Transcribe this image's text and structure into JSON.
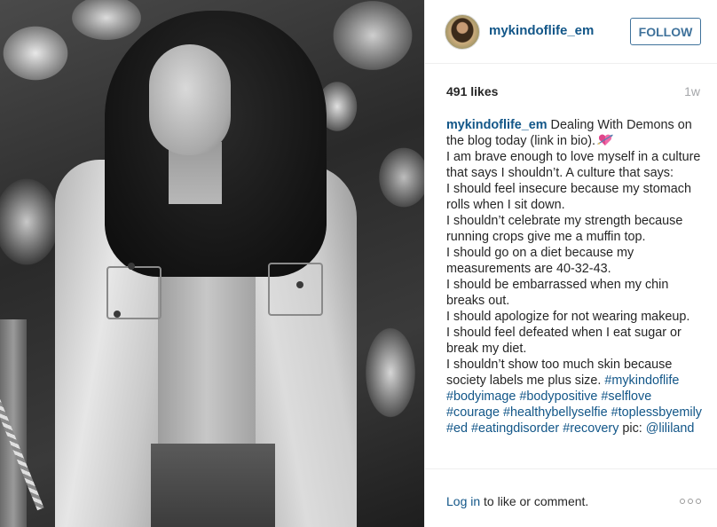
{
  "header": {
    "username": "mykindoflife_em",
    "follow_label": "FOLLOW"
  },
  "stats": {
    "likes": "491 likes",
    "age": "1w"
  },
  "caption": {
    "username": "mykindoflife_em",
    "lines": [
      " Dealing With Demons on the blog today (link in bio).",
      "I am brave enough to love myself in a culture that says I shouldn’t. A culture that says:",
      "I should feel insecure because my stomach rolls when I sit down.",
      "I shouldn’t celebrate my strength because running crops give me a muffin top.",
      "I should go on a diet because my measurements are 40-32-43.",
      "I should be embarrassed when my chin breaks out.",
      "I should apologize for not wearing makeup.",
      "I should feel defeated when I eat sugar or break my diet.",
      "I shouldn’t show too much skin because society labels me plus size. "
    ],
    "hashtags": [
      "#mykindoflife",
      "#bodyimage",
      "#bodypositive",
      "#selflove",
      "#courage",
      "#healthybellyselfie",
      "#toplessbyemily",
      "#ed",
      "#eatingdisorder",
      "#recovery"
    ],
    "credit_prefix": " pic: ",
    "credit_handle": "@lililand",
    "emoji": "heart-with-arrow-icon"
  },
  "footer": {
    "login_link": "Log in",
    "login_rest": " to like or comment."
  },
  "colors": {
    "link": "#125688",
    "follow": "#3f729b",
    "muted": "#a5a7aa",
    "text": "#262626"
  }
}
